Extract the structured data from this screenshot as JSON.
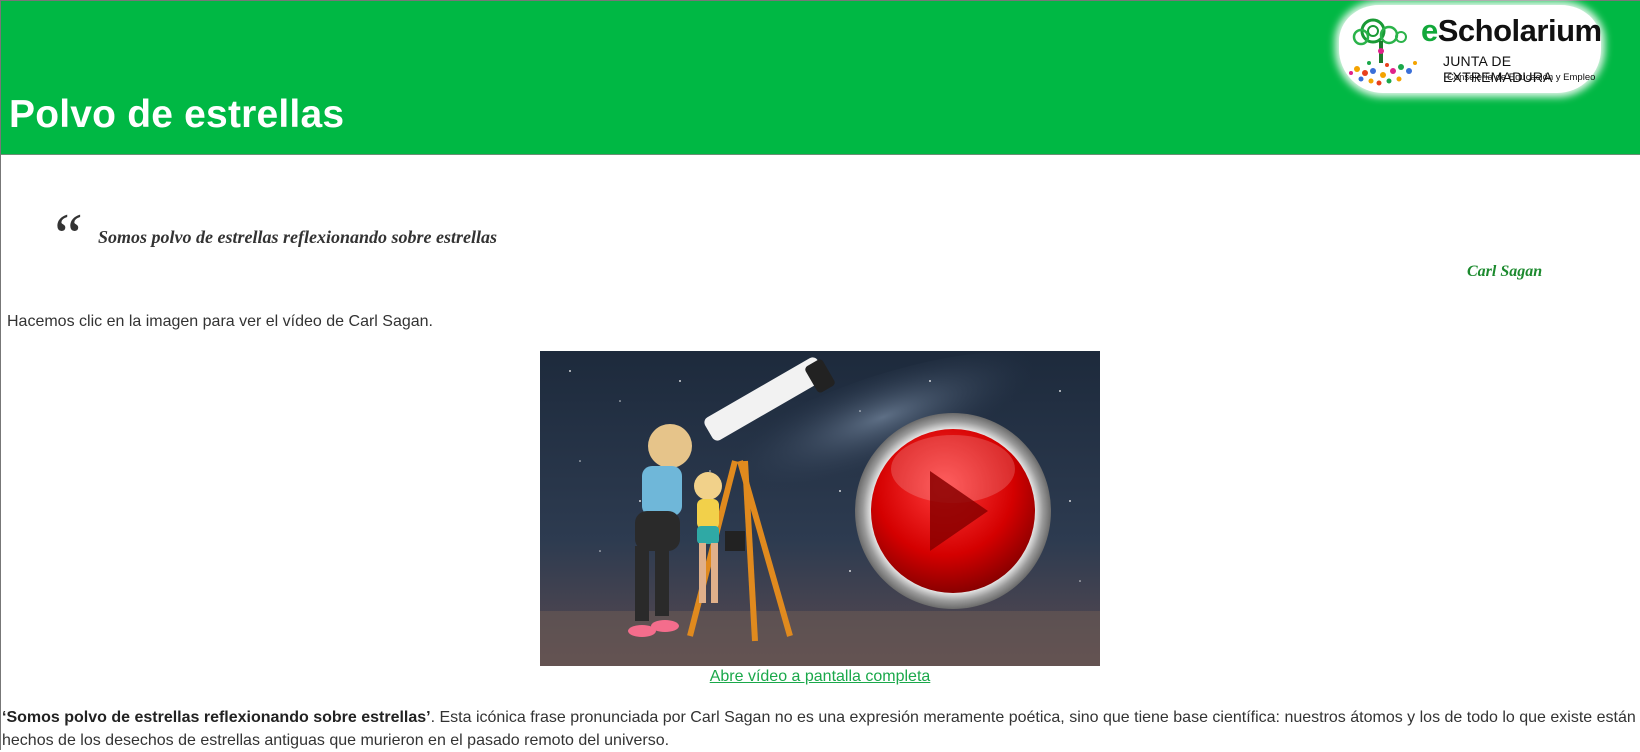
{
  "header": {
    "title": "Polvo de estrellas",
    "logo": {
      "brand_prefix": "e",
      "brand_rest": "Scholarium",
      "line1": "JUNTA DE EXTREMADURA",
      "line2": "Consejería de Educación y Empleo"
    },
    "color": "#00b844"
  },
  "quote": {
    "mark": "“",
    "text": "Somos polvo de estrellas reflexionando sobre estrellas",
    "author": "Carl Sagan",
    "author_color": "#1c8a2e"
  },
  "intro": "Hacemos clic en la imagen para ver el vídeo de Carl Sagan.",
  "video": {
    "play_icon": "play-button-icon",
    "fullscreen_link": "Abre vídeo a pantalla completa"
  },
  "body": {
    "bold_quote": "‘Somos polvo de estrellas reflexionando sobre estrellas’",
    "text": ". Esta icónica frase pronunciada por Carl Sagan no es una expresión meramente poética, sino que tiene base científica: nuestros átomos y los de todo lo que existe están hechos de los desechos de estrellas antiguas que murieron en el pasado remoto del universo."
  }
}
